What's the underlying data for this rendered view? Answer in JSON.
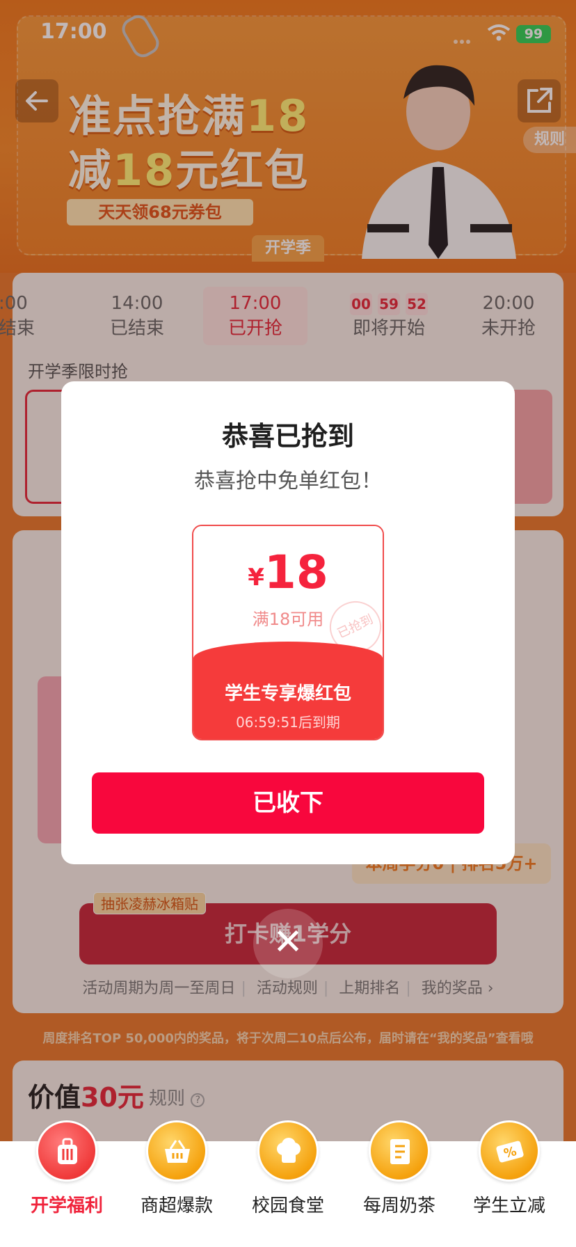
{
  "status_bar": {
    "time": "17:00",
    "battery": "99"
  },
  "banner": {
    "line1_prefix": "准点抢满",
    "line1_highlight": "18",
    "line2_prefix": "减",
    "line2_highlight": "18",
    "line2_suffix": "元红包",
    "sub_badge": "天天领68元券包",
    "season_tab": "开学季",
    "rules": "规则"
  },
  "time_slots": [
    {
      "time": ":00",
      "status": "结束"
    },
    {
      "time": "14:00",
      "status": "已结束"
    },
    {
      "time": "17:00",
      "status": "已开抢"
    },
    {
      "countdown": [
        "00",
        "59",
        "52"
      ],
      "status": "即将开始"
    },
    {
      "time": "20:00",
      "status": "未开抢"
    }
  ],
  "flash_sale_label": "开学季限时抢",
  "checkin": {
    "stat": "本周学分0 | 排名5万+",
    "raffle_tag": "抽张凌赫冰箱贴",
    "button": "打卡赚1学分",
    "links": [
      "活动周期为周一至周日",
      "活动规则",
      "上期排名",
      "我的奖品"
    ]
  },
  "notice": "周度排名TOP 50,000内的奖品，将于次周二10点后公布，届时请在“我的奖品”查看哦",
  "value_section": {
    "prefix": "价值",
    "amount": "30元",
    "rules": "规则"
  },
  "modal": {
    "title": "恭喜已抢到",
    "subtitle": "恭喜抢中免单红包！",
    "coupon": {
      "currency": "¥",
      "amount": "18",
      "condition": "满18可用",
      "stamp": "已抢到",
      "name": "学生专享爆红包",
      "expire": "06:59:51后到期"
    },
    "accept_button": "已收下",
    "close_icon": "close-icon"
  },
  "tabs": [
    {
      "label": "开学福利",
      "icon": "suitcase-icon",
      "active": true
    },
    {
      "label": "商超爆款",
      "icon": "basket-icon",
      "active": false
    },
    {
      "label": "校园食堂",
      "icon": "chef-hat-icon",
      "active": false
    },
    {
      "label": "每周奶茶",
      "icon": "book-icon",
      "active": false
    },
    {
      "label": "学生立减",
      "icon": "discount-coupon-icon",
      "active": false
    }
  ],
  "colors": {
    "accent": "#f8073d",
    "brand_orange": "#f07a1e",
    "coupon_red": "#f53b3b"
  }
}
